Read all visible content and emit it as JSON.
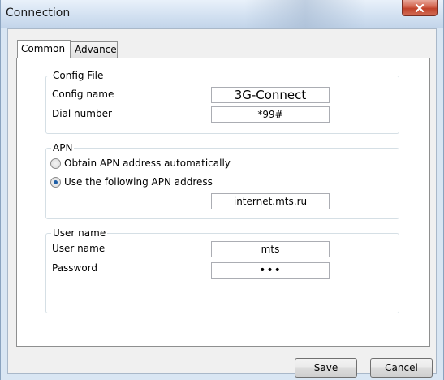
{
  "window": {
    "title": "Connection",
    "close_label": "x"
  },
  "tabs": [
    {
      "label": "Common",
      "selected": true
    },
    {
      "label": "Advance",
      "selected": false
    }
  ],
  "config_file": {
    "legend": "Config File",
    "config_name_label": "Config name",
    "config_name_value": "3G-Connect",
    "dial_number_label": "Dial number",
    "dial_number_value": "*99#"
  },
  "apn": {
    "legend": "APN",
    "auto_label": "Obtain APN address automatically",
    "auto_selected": false,
    "manual_label": "Use the following APN address",
    "manual_selected": true,
    "address_value": "internet.mts.ru"
  },
  "user": {
    "legend": "User name",
    "username_label": "User name",
    "username_value": "mts",
    "password_label": "Password",
    "password_value": "•••"
  },
  "buttons": {
    "save": "Save",
    "cancel": "Cancel"
  }
}
